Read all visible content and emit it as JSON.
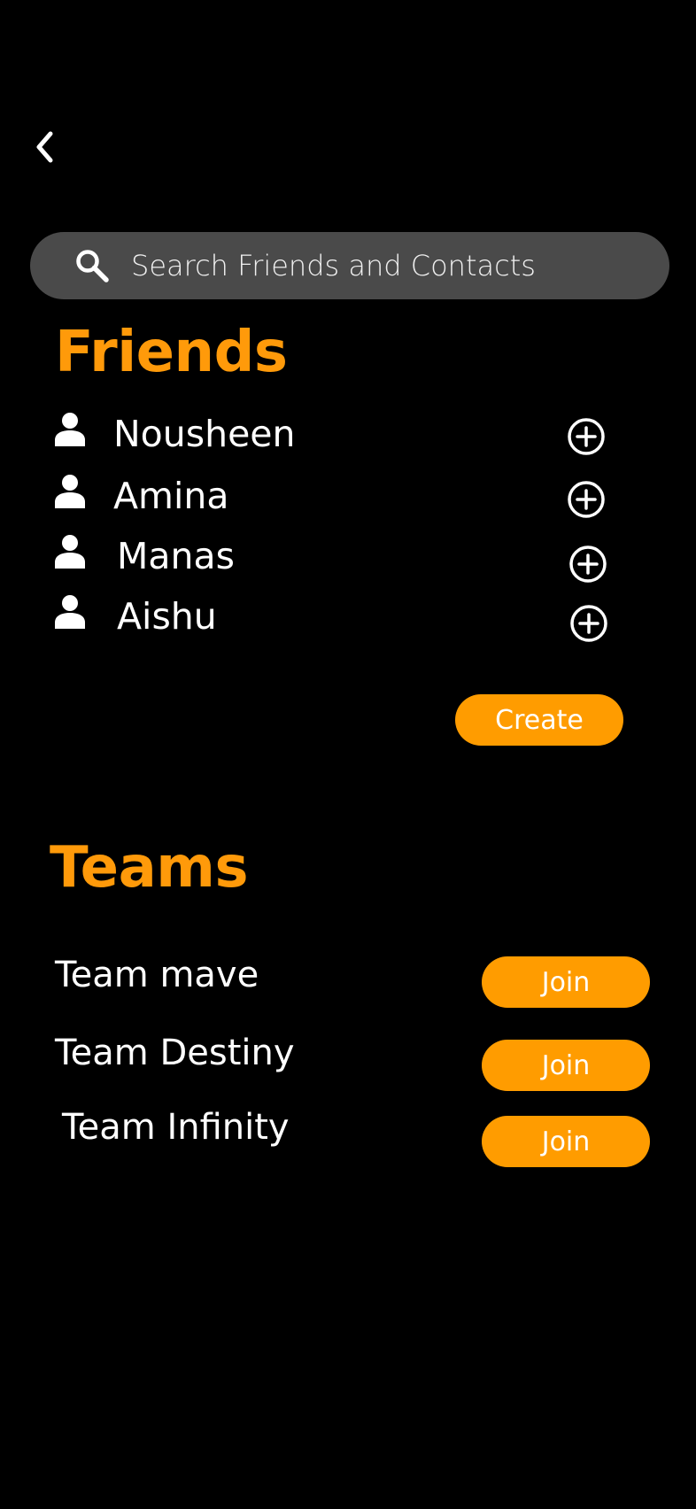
{
  "header": {
    "back_icon": "chevron-left-icon"
  },
  "search": {
    "icon": "search-icon",
    "placeholder": "Search Friends and Contacts",
    "value": ""
  },
  "friends": {
    "title": "Friends",
    "items": [
      {
        "name": "Nousheen",
        "icon": "person-icon",
        "action_icon": "add-circle-icon"
      },
      {
        "name": "Amina",
        "icon": "person-icon",
        "action_icon": "add-circle-icon"
      },
      {
        "name": "Manas",
        "icon": "person-icon",
        "action_icon": "add-circle-icon"
      },
      {
        "name": "Aishu",
        "icon": "person-icon",
        "action_icon": "add-circle-icon"
      }
    ],
    "create_label": "Create"
  },
  "teams": {
    "title": "Teams",
    "items": [
      {
        "name": "Team mave",
        "join_label": "Join"
      },
      {
        "name": "Team Destiny",
        "join_label": "Join"
      },
      {
        "name": "Team Infinity",
        "join_label": "Join"
      }
    ]
  },
  "colors": {
    "accent": "#ff9c00",
    "background": "#000000",
    "search_background": "#4a4a4a",
    "text": "#ffffff"
  }
}
